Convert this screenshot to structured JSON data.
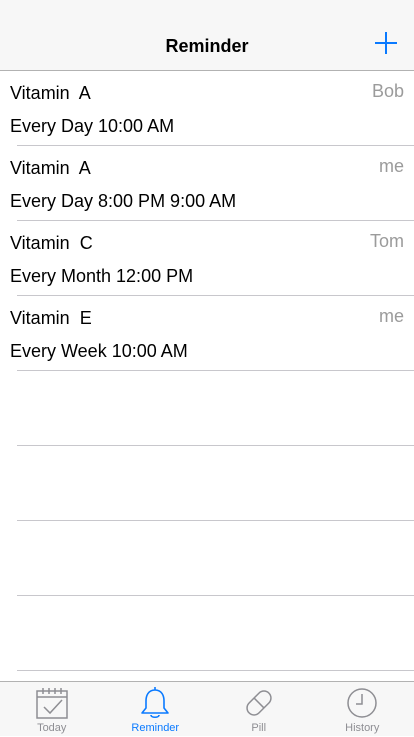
{
  "navbar": {
    "title": "Reminder"
  },
  "reminders": [
    {
      "medicine": "Vitamin  A",
      "owner": "Bob",
      "schedule": "Every Day 10:00 AM"
    },
    {
      "medicine": "Vitamin  A",
      "owner": "me",
      "schedule": "Every Day 8:00 PM 9:00 AM"
    },
    {
      "medicine": "Vitamin  C",
      "owner": "Tom",
      "schedule": "Every Month 12:00 PM"
    },
    {
      "medicine": "Vitamin  E",
      "owner": "me",
      "schedule": "Every Week 10:00 AM"
    }
  ],
  "tabs": [
    {
      "label": "Today",
      "icon": "calendar-check-icon"
    },
    {
      "label": "Reminder",
      "icon": "bell-icon",
      "active": true
    },
    {
      "label": "Pill",
      "icon": "pill-icon"
    },
    {
      "label": "History",
      "icon": "clock-icon"
    }
  ],
  "colors": {
    "accent": "#0a7aff",
    "inactive": "#8e8e93",
    "secondary_text": "#9b9b9b"
  }
}
